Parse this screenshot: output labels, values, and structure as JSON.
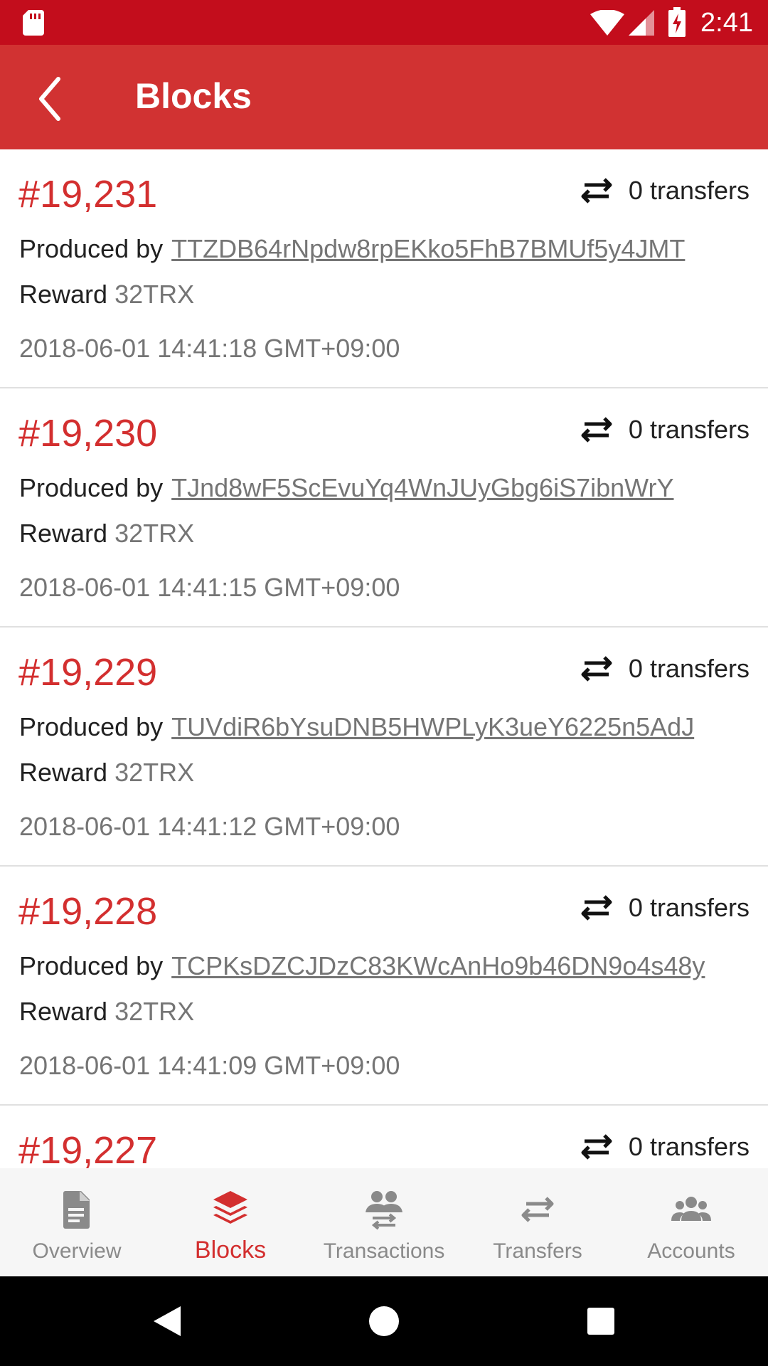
{
  "status_bar": {
    "time": "2:41",
    "icons": [
      "sd-card-icon",
      "wifi-icon",
      "signal-icon",
      "battery-charging-icon"
    ]
  },
  "app_bar": {
    "title": "Blocks",
    "back_icon": "chevron-left-icon"
  },
  "blocks": [
    {
      "number": "#19,231",
      "transfers": "0 transfers",
      "produced_by_label": "Produced by",
      "producer": "TTZDB64rNpdw8rpEKko5FhB7BMUf5y4JMT",
      "reward_label": "Reward",
      "reward": "32TRX",
      "timestamp": "2018-06-01 14:41:18 GMT+09:00"
    },
    {
      "number": "#19,230",
      "transfers": "0 transfers",
      "produced_by_label": "Produced by",
      "producer": "TJnd8wF5ScEvuYq4WnJUyGbg6iS7ibnWrY",
      "reward_label": "Reward",
      "reward": "32TRX",
      "timestamp": "2018-06-01 14:41:15 GMT+09:00"
    },
    {
      "number": "#19,229",
      "transfers": "0 transfers",
      "produced_by_label": "Produced by",
      "producer": "TUVdiR6bYsuDNB5HWPLyK3ueY6225n5AdJ",
      "reward_label": "Reward",
      "reward": "32TRX",
      "timestamp": "2018-06-01 14:41:12 GMT+09:00"
    },
    {
      "number": "#19,228",
      "transfers": "0 transfers",
      "produced_by_label": "Produced by",
      "producer": "TCPKsDZCJDzC83KWcAnHo9b46DN9o4s48y",
      "reward_label": "Reward",
      "reward": "32TRX",
      "timestamp": "2018-06-01 14:41:09 GMT+09:00"
    },
    {
      "number": "#19,227",
      "transfers": "0 transfers"
    }
  ],
  "bottom_nav": [
    {
      "label": "Overview",
      "icon": "document-icon",
      "active": false
    },
    {
      "label": "Blocks",
      "icon": "layers-icon",
      "active": true
    },
    {
      "label": "Transactions",
      "icon": "people-swap-icon",
      "active": false
    },
    {
      "label": "Transfers",
      "icon": "swap-arrows-icon",
      "active": false
    },
    {
      "label": "Accounts",
      "icon": "group-icon",
      "active": false
    }
  ],
  "colors": {
    "status_bar": "#c30d1c",
    "app_bar": "#d13232",
    "accent": "#d32f2f",
    "muted_text": "#757575",
    "nav_inactive": "#8a8a8a"
  }
}
